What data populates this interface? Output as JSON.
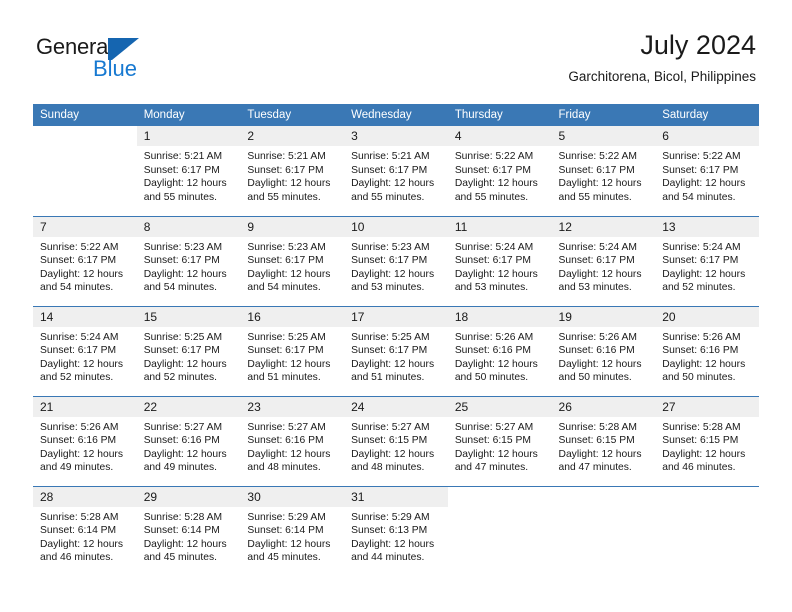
{
  "brand": {
    "name_part1": "General",
    "name_part2": "Blue",
    "accent_color": "#1779d1",
    "flag_icon": "flag-triangle-icon"
  },
  "header": {
    "title": "July 2024",
    "subtitle": "Garchitorena, Bicol, Philippines"
  },
  "theme": {
    "header_row_color": "#3a78b5",
    "daynum_band_color": "#efefef",
    "text_color": "#1a1a1a"
  },
  "weekday_headers": [
    "Sunday",
    "Monday",
    "Tuesday",
    "Wednesday",
    "Thursday",
    "Friday",
    "Saturday"
  ],
  "calendar_weeks": [
    [
      {
        "day": "",
        "blank": true
      },
      {
        "day": "1",
        "sunrise": "Sunrise: 5:21 AM",
        "sunset": "Sunset: 6:17 PM",
        "daylight1": "Daylight: 12 hours",
        "daylight2": "and 55 minutes."
      },
      {
        "day": "2",
        "sunrise": "Sunrise: 5:21 AM",
        "sunset": "Sunset: 6:17 PM",
        "daylight1": "Daylight: 12 hours",
        "daylight2": "and 55 minutes."
      },
      {
        "day": "3",
        "sunrise": "Sunrise: 5:21 AM",
        "sunset": "Sunset: 6:17 PM",
        "daylight1": "Daylight: 12 hours",
        "daylight2": "and 55 minutes."
      },
      {
        "day": "4",
        "sunrise": "Sunrise: 5:22 AM",
        "sunset": "Sunset: 6:17 PM",
        "daylight1": "Daylight: 12 hours",
        "daylight2": "and 55 minutes."
      },
      {
        "day": "5",
        "sunrise": "Sunrise: 5:22 AM",
        "sunset": "Sunset: 6:17 PM",
        "daylight1": "Daylight: 12 hours",
        "daylight2": "and 55 minutes."
      },
      {
        "day": "6",
        "sunrise": "Sunrise: 5:22 AM",
        "sunset": "Sunset: 6:17 PM",
        "daylight1": "Daylight: 12 hours",
        "daylight2": "and 54 minutes."
      }
    ],
    [
      {
        "day": "7",
        "sunrise": "Sunrise: 5:22 AM",
        "sunset": "Sunset: 6:17 PM",
        "daylight1": "Daylight: 12 hours",
        "daylight2": "and 54 minutes."
      },
      {
        "day": "8",
        "sunrise": "Sunrise: 5:23 AM",
        "sunset": "Sunset: 6:17 PM",
        "daylight1": "Daylight: 12 hours",
        "daylight2": "and 54 minutes."
      },
      {
        "day": "9",
        "sunrise": "Sunrise: 5:23 AM",
        "sunset": "Sunset: 6:17 PM",
        "daylight1": "Daylight: 12 hours",
        "daylight2": "and 54 minutes."
      },
      {
        "day": "10",
        "sunrise": "Sunrise: 5:23 AM",
        "sunset": "Sunset: 6:17 PM",
        "daylight1": "Daylight: 12 hours",
        "daylight2": "and 53 minutes."
      },
      {
        "day": "11",
        "sunrise": "Sunrise: 5:24 AM",
        "sunset": "Sunset: 6:17 PM",
        "daylight1": "Daylight: 12 hours",
        "daylight2": "and 53 minutes."
      },
      {
        "day": "12",
        "sunrise": "Sunrise: 5:24 AM",
        "sunset": "Sunset: 6:17 PM",
        "daylight1": "Daylight: 12 hours",
        "daylight2": "and 53 minutes."
      },
      {
        "day": "13",
        "sunrise": "Sunrise: 5:24 AM",
        "sunset": "Sunset: 6:17 PM",
        "daylight1": "Daylight: 12 hours",
        "daylight2": "and 52 minutes."
      }
    ],
    [
      {
        "day": "14",
        "sunrise": "Sunrise: 5:24 AM",
        "sunset": "Sunset: 6:17 PM",
        "daylight1": "Daylight: 12 hours",
        "daylight2": "and 52 minutes."
      },
      {
        "day": "15",
        "sunrise": "Sunrise: 5:25 AM",
        "sunset": "Sunset: 6:17 PM",
        "daylight1": "Daylight: 12 hours",
        "daylight2": "and 52 minutes."
      },
      {
        "day": "16",
        "sunrise": "Sunrise: 5:25 AM",
        "sunset": "Sunset: 6:17 PM",
        "daylight1": "Daylight: 12 hours",
        "daylight2": "and 51 minutes."
      },
      {
        "day": "17",
        "sunrise": "Sunrise: 5:25 AM",
        "sunset": "Sunset: 6:17 PM",
        "daylight1": "Daylight: 12 hours",
        "daylight2": "and 51 minutes."
      },
      {
        "day": "18",
        "sunrise": "Sunrise: 5:26 AM",
        "sunset": "Sunset: 6:16 PM",
        "daylight1": "Daylight: 12 hours",
        "daylight2": "and 50 minutes."
      },
      {
        "day": "19",
        "sunrise": "Sunrise: 5:26 AM",
        "sunset": "Sunset: 6:16 PM",
        "daylight1": "Daylight: 12 hours",
        "daylight2": "and 50 minutes."
      },
      {
        "day": "20",
        "sunrise": "Sunrise: 5:26 AM",
        "sunset": "Sunset: 6:16 PM",
        "daylight1": "Daylight: 12 hours",
        "daylight2": "and 50 minutes."
      }
    ],
    [
      {
        "day": "21",
        "sunrise": "Sunrise: 5:26 AM",
        "sunset": "Sunset: 6:16 PM",
        "daylight1": "Daylight: 12 hours",
        "daylight2": "and 49 minutes."
      },
      {
        "day": "22",
        "sunrise": "Sunrise: 5:27 AM",
        "sunset": "Sunset: 6:16 PM",
        "daylight1": "Daylight: 12 hours",
        "daylight2": "and 49 minutes."
      },
      {
        "day": "23",
        "sunrise": "Sunrise: 5:27 AM",
        "sunset": "Sunset: 6:16 PM",
        "daylight1": "Daylight: 12 hours",
        "daylight2": "and 48 minutes."
      },
      {
        "day": "24",
        "sunrise": "Sunrise: 5:27 AM",
        "sunset": "Sunset: 6:15 PM",
        "daylight1": "Daylight: 12 hours",
        "daylight2": "and 48 minutes."
      },
      {
        "day": "25",
        "sunrise": "Sunrise: 5:27 AM",
        "sunset": "Sunset: 6:15 PM",
        "daylight1": "Daylight: 12 hours",
        "daylight2": "and 47 minutes."
      },
      {
        "day": "26",
        "sunrise": "Sunrise: 5:28 AM",
        "sunset": "Sunset: 6:15 PM",
        "daylight1": "Daylight: 12 hours",
        "daylight2": "and 47 minutes."
      },
      {
        "day": "27",
        "sunrise": "Sunrise: 5:28 AM",
        "sunset": "Sunset: 6:15 PM",
        "daylight1": "Daylight: 12 hours",
        "daylight2": "and 46 minutes."
      }
    ],
    [
      {
        "day": "28",
        "sunrise": "Sunrise: 5:28 AM",
        "sunset": "Sunset: 6:14 PM",
        "daylight1": "Daylight: 12 hours",
        "daylight2": "and 46 minutes."
      },
      {
        "day": "29",
        "sunrise": "Sunrise: 5:28 AM",
        "sunset": "Sunset: 6:14 PM",
        "daylight1": "Daylight: 12 hours",
        "daylight2": "and 45 minutes."
      },
      {
        "day": "30",
        "sunrise": "Sunrise: 5:29 AM",
        "sunset": "Sunset: 6:14 PM",
        "daylight1": "Daylight: 12 hours",
        "daylight2": "and 45 minutes."
      },
      {
        "day": "31",
        "sunrise": "Sunrise: 5:29 AM",
        "sunset": "Sunset: 6:13 PM",
        "daylight1": "Daylight: 12 hours",
        "daylight2": "and 44 minutes."
      },
      {
        "day": "",
        "blank": true
      },
      {
        "day": "",
        "blank": true
      },
      {
        "day": "",
        "blank": true
      }
    ]
  ]
}
